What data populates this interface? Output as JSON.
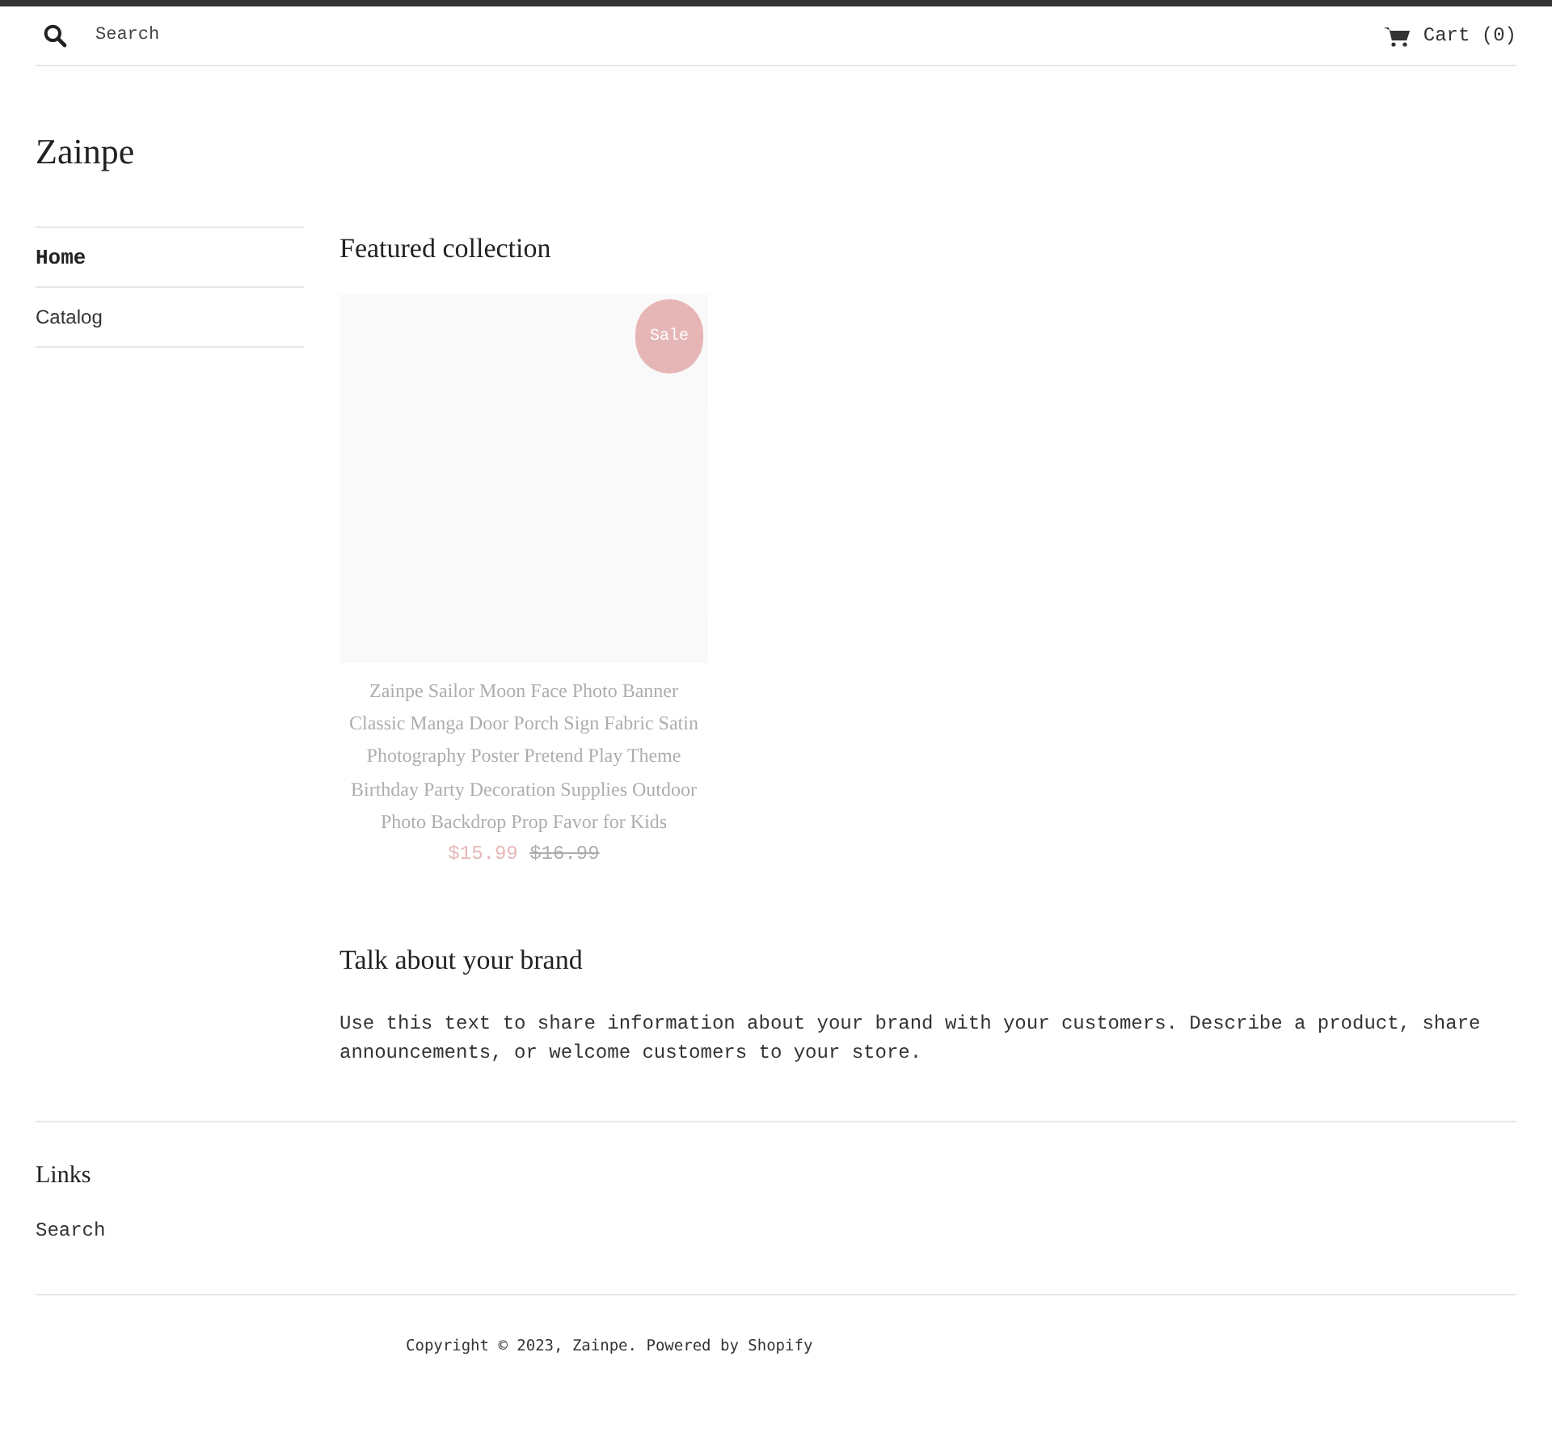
{
  "header": {
    "search": {
      "placeholder": "Search"
    },
    "cart": {
      "label": "Cart",
      "count": "(0)"
    }
  },
  "logo": "Zainpe",
  "sidebar": {
    "items": [
      {
        "label": "Home",
        "selected": true
      },
      {
        "label": "Catalog",
        "selected": false
      }
    ]
  },
  "featured": {
    "title": "Featured collection",
    "products": [
      {
        "badge": "Sale",
        "title": "Zainpe Sailor Moon Face Photo Banner Classic Manga Door Porch Sign Fabric Satin Photography Poster Pretend Play Theme Birthday Party Decoration Supplies Outdoor Photo Backdrop Prop Favor for Kids",
        "price": "$15.99",
        "compare_price": "$16.99",
        "faded": true
      }
    ]
  },
  "brand": {
    "title": "Talk about your brand",
    "text": "Use this text to share information about your brand with your customers. Describe a product, share announcements, or welcome customers to your store."
  },
  "footer": {
    "links_title": "Links",
    "links": [
      "Search"
    ],
    "copyright": {
      "prefix": "Copyright © 2023, ",
      "store": "Zainpe",
      "separator": ". ",
      "powered": "Powered by Shopify"
    }
  }
}
